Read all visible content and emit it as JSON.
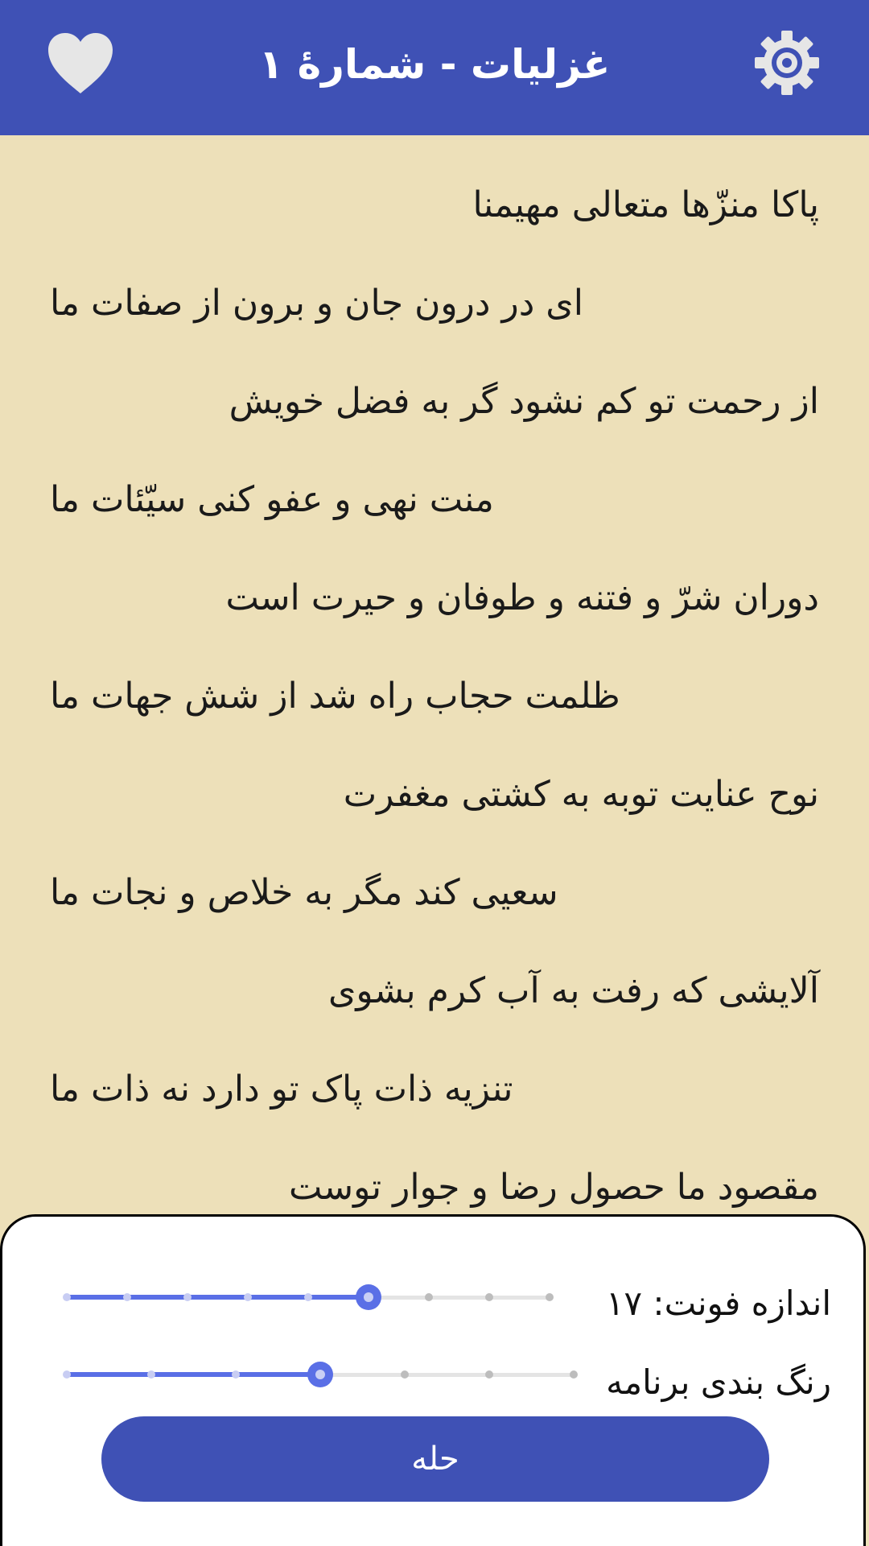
{
  "header": {
    "title": "غزلیات - شمارهٔ ۱",
    "favorite_icon": "heart-icon",
    "settings_icon": "gear-icon",
    "bar_color": "#3f51b5"
  },
  "poem": {
    "verses": [
      "پاکا منزّها متعالی مهیمنا",
      "ای در درون جان و برون از صفات ما",
      "از رحمت تو کم نشود گر به فضل خویش",
      "منت نهی و عفو کنی سیّئات ما",
      "دوران شرّ و فتنه و طوفان و حیرت است",
      "ظلمت حجاب راه شد از شش جهات ما",
      "نوح عنایت توبه به کشتی مغفرت",
      "سعیی کند مگر به خلاص و نجات ما",
      "آلایشی که رفت به آب کرم بشوی",
      "تنزیه ذات پاک تو دارد نه ذات ما",
      "مقصود ما حصول رضا و جوار توست"
    ],
    "background_color": "#ede0b9"
  },
  "settings_sheet": {
    "font_size_label": "اندازه فونت: ۱۷",
    "font_size_slider": {
      "steps": 9,
      "selected_index": 5
    },
    "theme_label": "رنگ بندی برنامه",
    "theme_slider": {
      "steps": 7,
      "selected_index": 3
    },
    "done_button_label": "حله",
    "accent_color": "#5a6fe6"
  }
}
